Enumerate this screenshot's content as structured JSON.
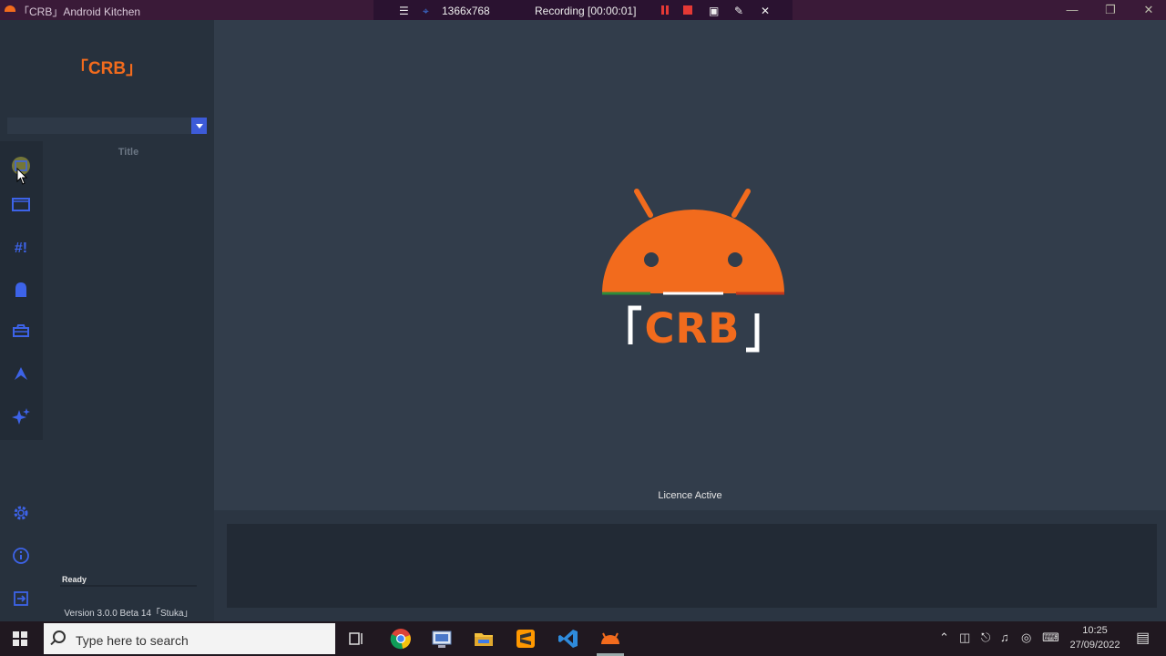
{
  "window": {
    "title": "「CRB」Android Kitchen",
    "minimize": "—",
    "restore": "❐",
    "close": "✕"
  },
  "recorder": {
    "resolution": "1366x768",
    "status": "Recording [00:00:01]",
    "close": "✕",
    "menu": "☰",
    "pin": "⌖",
    "camera": "▣",
    "pen": "✎"
  },
  "sidebar": {
    "logo": "「CRB」",
    "column_title": "Title",
    "status": "Ready",
    "version": "Version 3.0.0 Beta 14「Stuka」",
    "rail_icons": [
      "image-icon",
      "folder-icon",
      "hash-icon",
      "android-icon",
      "toolbox-icon",
      "tool-icon",
      "sparkle-icon"
    ],
    "bottom_icons": [
      "gear-icon",
      "info-icon",
      "exit-icon"
    ]
  },
  "main": {
    "logo_text": "「CRB」",
    "licence": "Licence Active"
  },
  "taskbar": {
    "search_placeholder": "Type here to search",
    "time": "10:25",
    "date": "27/09/2022",
    "apps": [
      "task-view-icon",
      "chrome-icon",
      "network-app-icon",
      "file-explorer-icon",
      "sublime-icon",
      "vscode-icon",
      "crb-kitchen-icon"
    ]
  },
  "colors": {
    "accent_orange": "#f26b1d",
    "accent_blue": "#3d63e8",
    "panel_bg": "#323d4b",
    "sidebar_bg": "#27313d"
  }
}
